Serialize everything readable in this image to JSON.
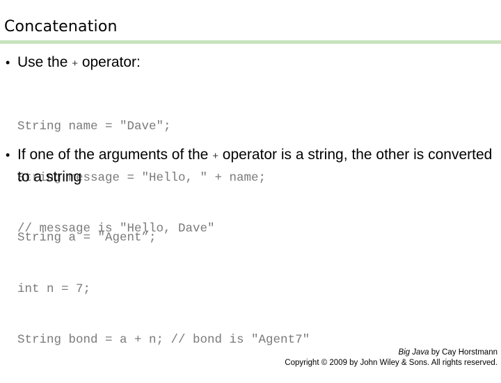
{
  "slide": {
    "title": "Concatenation",
    "accent_color": "#c8e3bd"
  },
  "bullets": [
    {
      "before": "Use the ",
      "operator": "+",
      "after": " operator:",
      "code": [
        "String name = \"Dave\";",
        "String message = \"Hello, \" + name;",
        "// message is \"Hello, Dave\""
      ]
    },
    {
      "before": "If one of the arguments of the ",
      "operator": "+",
      "after": " operator is a string, the other is converted to a string",
      "code": [
        "String a = \"Agent”;",
        "int n = 7;",
        "String bond = a + n; // bond is \"Agent7\""
      ]
    }
  ],
  "footer": {
    "book_title": "Big Java",
    "author_line": " by Cay Horstmann",
    "copyright": "Copyright © 2009 by John Wiley & Sons.  All rights reserved."
  }
}
